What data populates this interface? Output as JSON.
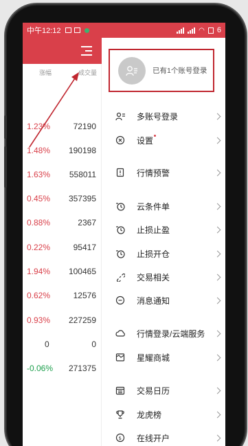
{
  "status_bar": {
    "time": "中午12:12",
    "battery": "6"
  },
  "stock_list": {
    "col_change": "涨幅",
    "col_volume": "成交量",
    "rows": [
      {
        "change": "1.23%",
        "volume": "72190",
        "trend": "up"
      },
      {
        "change": "1.48%",
        "volume": "190198",
        "trend": "up"
      },
      {
        "change": "1.63%",
        "volume": "558011",
        "trend": "up"
      },
      {
        "change": "0.45%",
        "volume": "357395",
        "trend": "up"
      },
      {
        "change": "0.88%",
        "volume": "2367",
        "trend": "up"
      },
      {
        "change": "0.22%",
        "volume": "95417",
        "trend": "up"
      },
      {
        "change": "1.94%",
        "volume": "100465",
        "trend": "up"
      },
      {
        "change": "0.62%",
        "volume": "12576",
        "trend": "up"
      },
      {
        "change": "0.93%",
        "volume": "227259",
        "trend": "up"
      },
      {
        "change": "0",
        "volume": "0",
        "trend": "flat"
      },
      {
        "change": "-0.06%",
        "volume": "271375",
        "trend": "down"
      }
    ]
  },
  "drawer": {
    "account_text": "已有1个账号登录",
    "menu": [
      {
        "label": "多账号登录",
        "icon": "multi-account-icon"
      },
      {
        "label": "设置",
        "icon": "settings-icon",
        "badge": true
      },
      {
        "label": "行情预警",
        "icon": "alert-icon"
      },
      {
        "label": "云条件单",
        "icon": "cloud-order-icon"
      },
      {
        "label": "止损止盈",
        "icon": "stop-profit-icon"
      },
      {
        "label": "止损开仓",
        "icon": "stop-open-icon"
      },
      {
        "label": "交易相关",
        "icon": "link-icon"
      },
      {
        "label": "消息通知",
        "icon": "message-icon"
      },
      {
        "label": "行情登录/云端服务",
        "icon": "cloud-service-icon"
      },
      {
        "label": "星耀商城",
        "icon": "store-icon"
      },
      {
        "label": "交易日历",
        "icon": "calendar-icon"
      },
      {
        "label": "龙虎榜",
        "icon": "trophy-icon"
      },
      {
        "label": "在线开户",
        "icon": "open-account-icon"
      }
    ]
  },
  "colors": {
    "brand_red": "#d9404a",
    "highlight_box": "#c0262f",
    "down_green": "#1b9e4b"
  }
}
